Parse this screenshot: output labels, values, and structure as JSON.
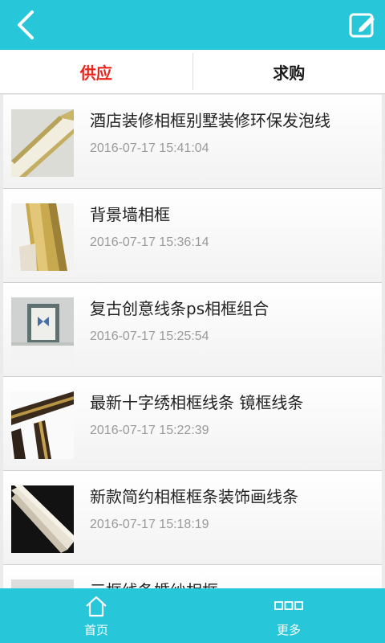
{
  "header": {
    "back_icon": "chevron-left-icon",
    "edit_icon": "edit-note-icon",
    "bar_color": "#27c6d9"
  },
  "tabs": [
    {
      "label": "供应",
      "active": true,
      "color": "#e8261e"
    },
    {
      "label": "求购",
      "active": false
    }
  ],
  "items": [
    {
      "title": "酒店装修相框别墅装修环保发泡线",
      "date": "2016-07-17 15:41:04",
      "thumb": "white-gold-molding"
    },
    {
      "title": "背景墙相框",
      "date": "2016-07-17 15:36:14",
      "thumb": "gold-ornate-molding"
    },
    {
      "title": "复古创意线条ps相框组合",
      "date": "2016-07-17 15:25:54",
      "thumb": "butterfly-frame"
    },
    {
      "title": "最新十字绣相框线条 镜框线条",
      "date": "2016-07-17 15:22:39",
      "thumb": "dark-gold-corner"
    },
    {
      "title": "新款简约相框框条装饰画线条",
      "date": "2016-07-17 15:18:19",
      "thumb": "white-angle-molding"
    },
    {
      "title": "三框线条婚纱相框",
      "date": "",
      "thumb": ""
    }
  ],
  "bottom_nav": [
    {
      "label": "首页",
      "icon": "home-icon"
    },
    {
      "label": "更多",
      "icon": "more-dots-icon"
    }
  ]
}
